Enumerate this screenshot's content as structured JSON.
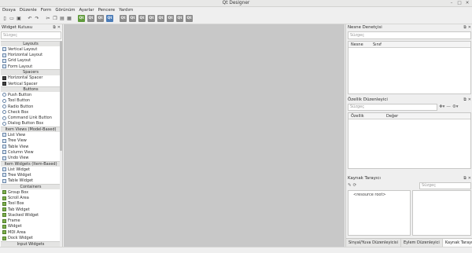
{
  "window": {
    "title": "Qt Designer"
  },
  "menu": [
    "Dosya",
    "Düzenle",
    "Form",
    "Görünüm",
    "Ayarlar",
    "Pencere",
    "Yardım"
  ],
  "colors": {
    "canvas": "#c8c8c8",
    "qt_green": "#5f9a3b"
  },
  "widget_box": {
    "title": "Widget Kutusu",
    "filter_placeholder": "Süzgeç",
    "groups": [
      {
        "name": "Layouts",
        "items": [
          "Vertical Layout",
          "Horizontal Layout",
          "Grid Layout",
          "Form Layout"
        ]
      },
      {
        "name": "Spacers",
        "items": [
          "Horizontal Spacer",
          "Vertical Spacer"
        ]
      },
      {
        "name": "Buttons",
        "items": [
          "Push Button",
          "Tool Button",
          "Radio Button",
          "Check Box",
          "Command Link Button",
          "Dialog Button Box"
        ]
      },
      {
        "name": "Item Views (Model-Based)",
        "items": [
          "List View",
          "Tree View",
          "Table View",
          "Column View",
          "Undo View"
        ]
      },
      {
        "name": "Item Widgets (Item-Based)",
        "items": [
          "List Widget",
          "Tree Widget",
          "Table Widget"
        ]
      },
      {
        "name": "Containers",
        "items": [
          "Group Box",
          "Scroll Area",
          "Tool Box",
          "Tab Widget",
          "Stacked Widget",
          "Frame",
          "Widget",
          "MDI Area",
          "Dock Widget"
        ]
      }
    ],
    "partial_group": "Input Widgets"
  },
  "object_inspector": {
    "title": "Nesne Denetçisi",
    "filter_placeholder": "Süzgeç",
    "columns": [
      "Nesne",
      "Sınıf"
    ]
  },
  "property_editor": {
    "title": "Özellik Düzenleyici",
    "filter_placeholder": "Süzgeç",
    "columns": [
      "Özellik",
      "Değer"
    ]
  },
  "resource_browser": {
    "title": "Kaynak Tarayıcı",
    "filter_placeholder": "Süzgeç",
    "root": "<resource root>"
  },
  "bottom_tabs": [
    "Sinyal/Yuva Düzenleyicisi",
    "Eylem Düzenleyici",
    "Kaynak Tarayıcı"
  ],
  "active_tab": "Kaynak Tarayıcı"
}
